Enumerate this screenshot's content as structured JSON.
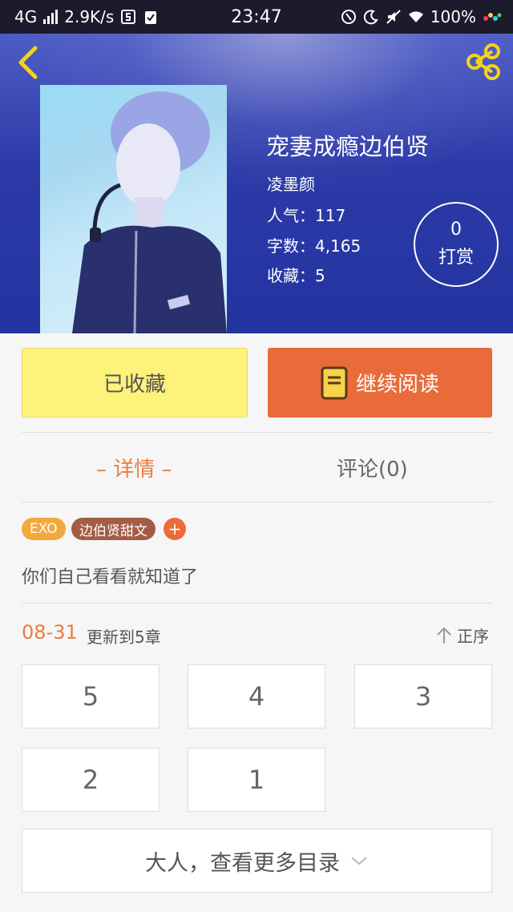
{
  "status_bar": {
    "network": "4G",
    "speed": "2.9K/s",
    "time": "23:47",
    "battery": "100%"
  },
  "book": {
    "title": "宠妻成瘾边伯贤",
    "author": "凌墨颜",
    "popularity": "人气：117",
    "word_count": "字数：4,165",
    "favorites": "收藏：5"
  },
  "tip": {
    "count": "0",
    "label": "打赏"
  },
  "actions": {
    "favorited_label": "已收藏",
    "continue_label": "继续阅读"
  },
  "tabs": {
    "details": "– 详情 –",
    "comments": "评论(0)"
  },
  "tags": [
    "EXO",
    "边伯贤甜文",
    "+"
  ],
  "intro": "你们自己看看就知道了",
  "update": {
    "date": "08-31",
    "text": "更新到5章",
    "sort_label": "正序"
  },
  "chapters": [
    "5",
    "4",
    "3",
    "2",
    "1"
  ],
  "more_label": "大人，查看更多目录",
  "colors": {
    "accent_orange": "#ec7b3f",
    "fav_yellow": "#fdf27a",
    "read_orange": "#e96b3a",
    "hero_blue": "#2c3aa7"
  },
  "icons": [
    "back-chevron-icon",
    "share-icon",
    "book-icon",
    "arrow-up-icon",
    "chevron-down-icon"
  ]
}
